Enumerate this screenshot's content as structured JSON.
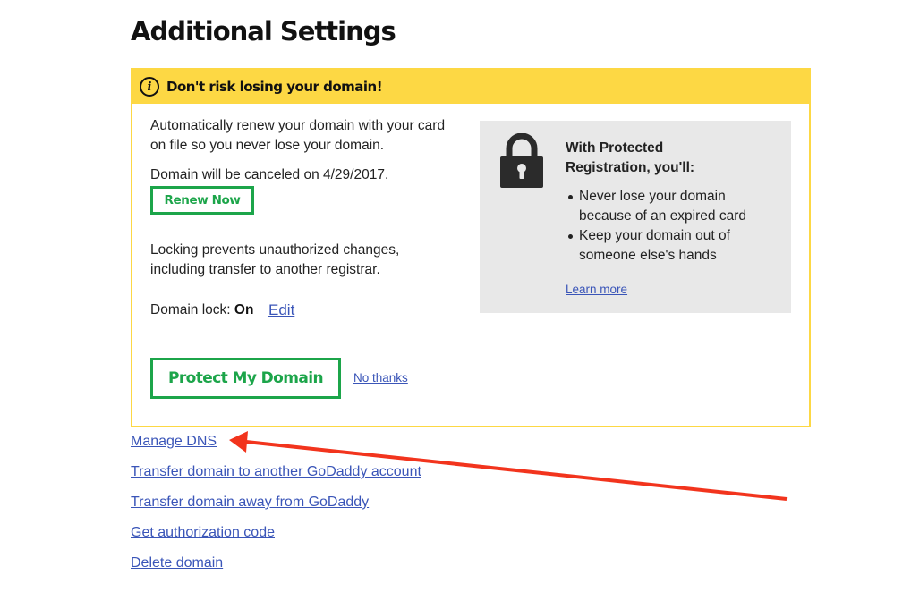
{
  "page": {
    "title": "Additional Settings"
  },
  "alert": {
    "title": "Don't risk losing your domain!",
    "icon": "info-icon",
    "renew_text": "Automatically renew your domain with your card on file so you never lose your domain.",
    "cancel_text": "Domain will be canceled on 4/29/2017.",
    "renew_button": "Renew Now",
    "lock_text": "Locking prevents unauthorized changes, including transfer to another registrar.",
    "domain_lock_label": "Domain lock:",
    "domain_lock_value": "On",
    "edit_link": "Edit",
    "protect_button": "Protect My Domain",
    "no_thanks_link": "No thanks"
  },
  "promo": {
    "icon": "lock-icon",
    "title": "With Protected Registration, you'll:",
    "bullets": [
      "Never lose your domain because of an expired card",
      "Keep your domain out of someone else's hands"
    ],
    "learn_more": "Learn more"
  },
  "links": [
    "Manage DNS",
    "Transfer domain to another GoDaddy account",
    "Transfer domain away from GoDaddy",
    "Get authorization code",
    "Delete domain"
  ],
  "annotation": {
    "arrow_color": "#f2341d",
    "points_to": "Manage DNS"
  },
  "colors": {
    "alert_yellow": "#fdd844",
    "button_green": "#1ca54a",
    "link_blue": "#3a55b8",
    "panel_gray": "#e8e8e8"
  }
}
